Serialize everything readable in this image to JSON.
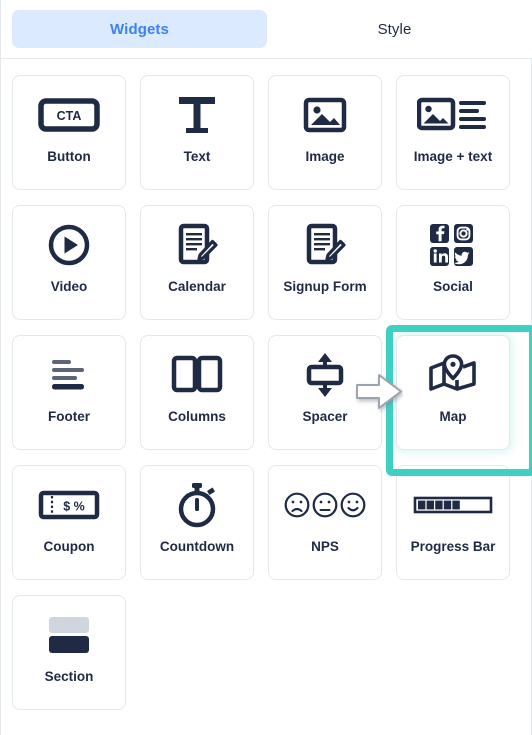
{
  "tabs": [
    {
      "label": "Widgets",
      "active": true
    },
    {
      "label": "Style",
      "active": false
    }
  ],
  "colors": {
    "accent_blue": "#3b82f6",
    "tab_active_bg": "#dbeafe",
    "icon_navy": "#1f2a44",
    "highlight_teal": "#3ed0c2",
    "card_border": "#e4e7ec",
    "section_light": "#cfd6dd"
  },
  "widgets": [
    {
      "label": "Button",
      "icon": "cta-button-icon",
      "selected": false
    },
    {
      "label": "Text",
      "icon": "text-t-icon",
      "selected": false
    },
    {
      "label": "Image",
      "icon": "image-icon",
      "selected": false
    },
    {
      "label": "Image + text",
      "icon": "image-text-icon",
      "selected": false
    },
    {
      "label": "Video",
      "icon": "play-circle-icon",
      "selected": false
    },
    {
      "label": "Calendar",
      "icon": "document-pencil-icon",
      "selected": false
    },
    {
      "label": "Signup Form",
      "icon": "document-pencil-icon",
      "selected": false
    },
    {
      "label": "Social",
      "icon": "social-grid-icon",
      "selected": false
    },
    {
      "label": "Footer",
      "icon": "footer-lines-icon",
      "selected": false
    },
    {
      "label": "Columns",
      "icon": "columns-icon",
      "selected": false
    },
    {
      "label": "Spacer",
      "icon": "spacer-arrows-icon",
      "selected": false
    },
    {
      "label": "Map",
      "icon": "map-pin-icon",
      "selected": true
    },
    {
      "label": "Coupon",
      "icon": "coupon-ticket-icon",
      "selected": false
    },
    {
      "label": "Countdown",
      "icon": "stopwatch-icon",
      "selected": false
    },
    {
      "label": "NPS",
      "icon": "faces-icon",
      "selected": false
    },
    {
      "label": "Progress Bar",
      "icon": "progress-bar-icon",
      "selected": false
    },
    {
      "label": "Section",
      "icon": "section-blocks-icon",
      "selected": false
    }
  ],
  "button_icon_text": "CTA",
  "coupon_icon_text": "$ %",
  "text_icon_glyph": "T",
  "cursor": {
    "name": "pointer-arrow",
    "direction": "right"
  },
  "progress_bar": {
    "segments_total": 9,
    "segments_filled": 5
  }
}
